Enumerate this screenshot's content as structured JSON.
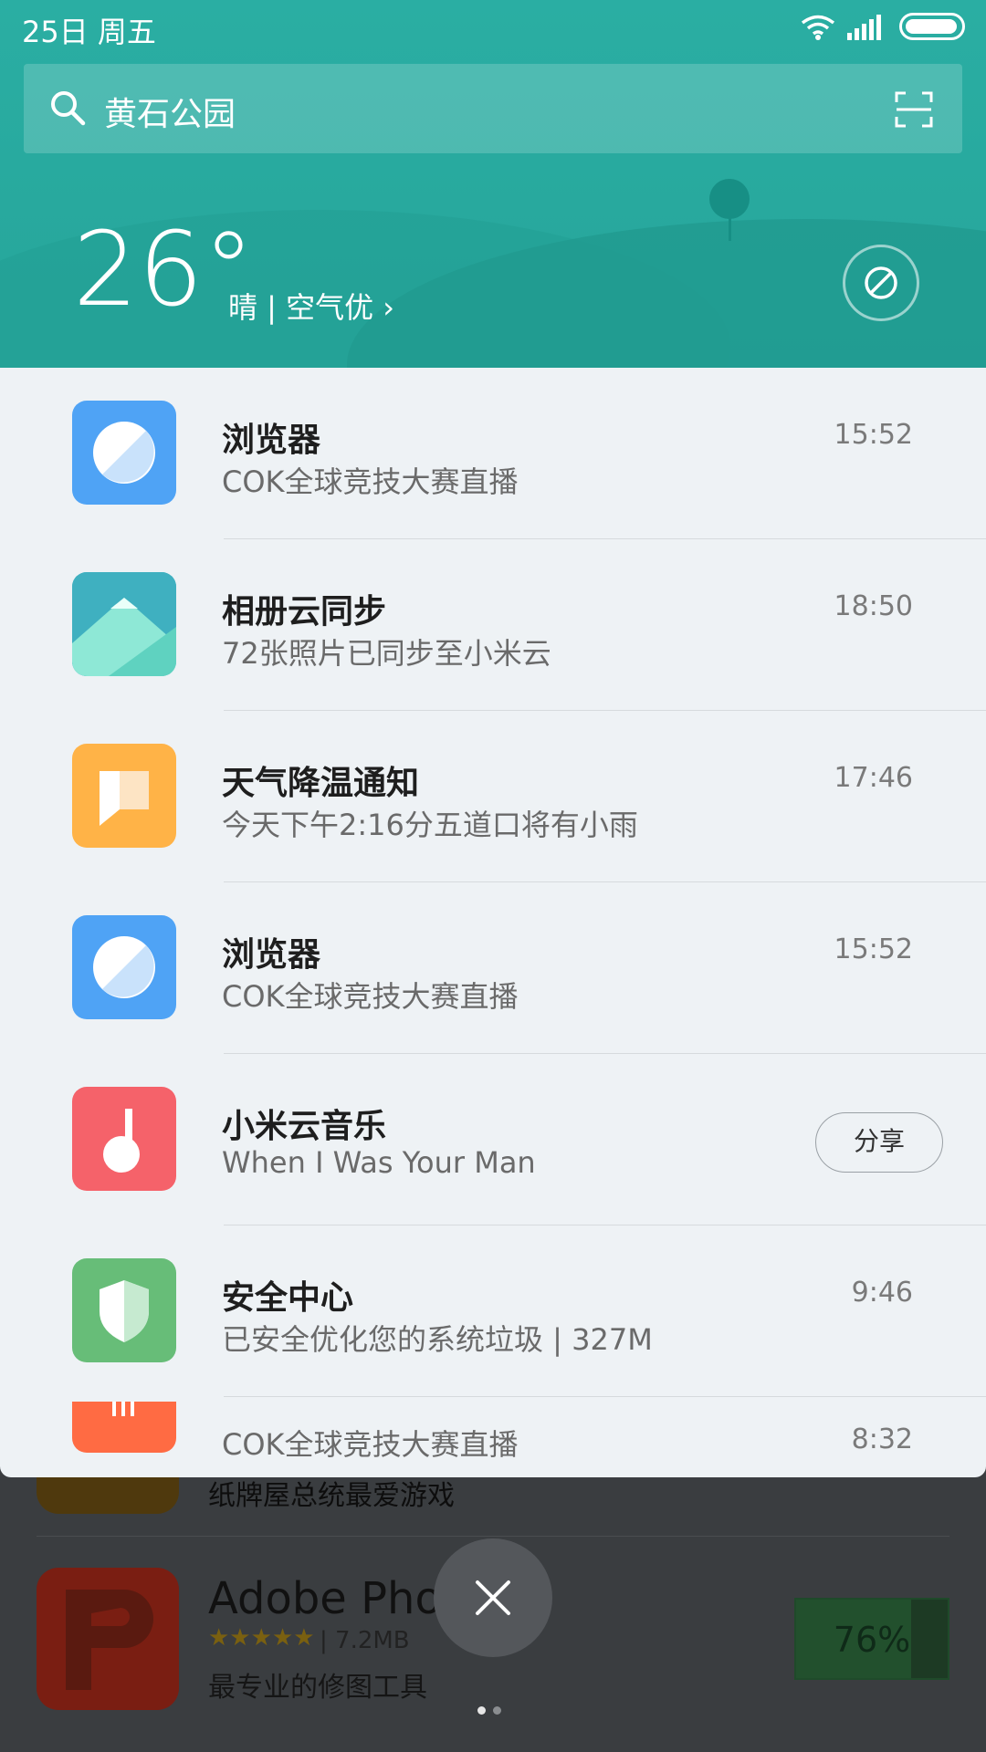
{
  "status_bar": {
    "date": "25日 周五"
  },
  "search": {
    "query": "黄石公园"
  },
  "weather": {
    "temperature": "26°",
    "summary": "晴 | 空气优 ›"
  },
  "notifications": [
    {
      "app": "浏览器",
      "message": "COK全球竞技大赛直播",
      "time": "15:52",
      "icon": "browser-icon",
      "color": "#4fa3f5"
    },
    {
      "app": "相册云同步",
      "message": "72张照片已同步至小米云",
      "time": "18:50",
      "icon": "gallery-icon",
      "color": "#3fb0c0"
    },
    {
      "app": "天气降温通知",
      "message": "今天下午2:16分五道口将有小雨",
      "time": "17:46",
      "icon": "message-icon",
      "color": "#ffb347"
    },
    {
      "app": "浏览器",
      "message": "COK全球竞技大赛直播",
      "time": "15:52",
      "icon": "browser-icon",
      "color": "#4fa3f5"
    },
    {
      "app": "小米云音乐",
      "message": "When I Was Your Man",
      "action": "分享",
      "icon": "music-icon",
      "color": "#f5626a"
    },
    {
      "app": "安全中心",
      "message": "已安全优化您的系统垃圾 | 327M",
      "time": "9:46",
      "icon": "shield-icon",
      "color": "#67bd78"
    },
    {
      "message": "COK全球竞技大赛直播",
      "time": "8:32",
      "icon": "mi-icon",
      "color": "#ff6b43"
    }
  ],
  "background_apps": [
    {
      "description": "纸牌屋总统最爱游戏"
    },
    {
      "title": "Adobe Photo",
      "stars": "★★★★★",
      "size": "| 7.2MB",
      "description": "最专业的修图工具",
      "progress": "76%",
      "progress_value": 0.76
    }
  ],
  "pager": {
    "active_index": 0,
    "total": 2
  }
}
